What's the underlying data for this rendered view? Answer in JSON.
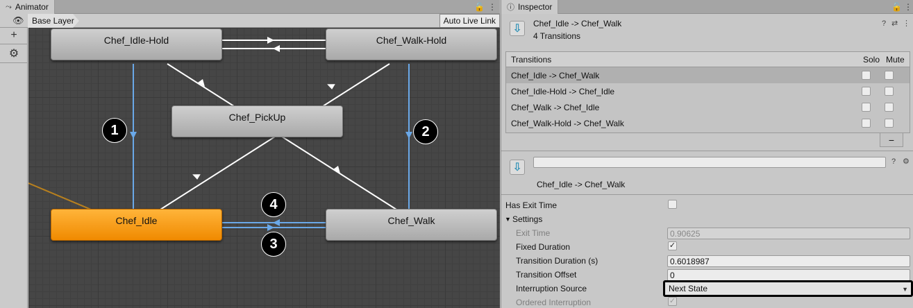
{
  "animator": {
    "tab_title": "Animator",
    "breadcrumb": "Base Layer",
    "auto_live_link": "Auto Live Link",
    "states": {
      "idle_hold": "Chef_Idle-Hold",
      "walk_hold": "Chef_Walk-Hold",
      "pickup": "Chef_PickUp",
      "idle": "Chef_Idle",
      "walk": "Chef_Walk"
    },
    "badges": [
      "1",
      "2",
      "3",
      "4"
    ],
    "colors": {
      "active_state": "#f39200",
      "highlight_transition": "#6aa8e8",
      "transition": "#ffffff",
      "entry_line": "#b8801e"
    }
  },
  "inspector": {
    "tab_title": "Inspector",
    "header_title": "Chef_Idle -> Chef_Walk",
    "header_subtitle": "4 Transitions",
    "transitions_header": "Transitions",
    "solo_label": "Solo",
    "mute_label": "Mute",
    "transitions": [
      "Chef_Idle -> Chef_Walk",
      "Chef_Idle-Hold -> Chef_Idle",
      "Chef_Walk -> Chef_Idle",
      "Chef_Walk-Hold -> Chef_Walk"
    ],
    "minus_label": "−",
    "selected_transition": "Chef_Idle -> Chef_Walk",
    "name_value": "",
    "has_exit_time_label": "Has Exit Time",
    "settings_label": "Settings",
    "exit_time_label": "Exit Time",
    "exit_time_value": "0.90625",
    "fixed_duration_label": "Fixed Duration",
    "transition_duration_label": "Transition Duration (s)",
    "transition_duration_value": "0.6018987",
    "transition_offset_label": "Transition Offset",
    "transition_offset_value": "0",
    "interruption_source_label": "Interruption Source",
    "interruption_source_value": "Next State",
    "ordered_interruption_label": "Ordered Interruption",
    "checkmark": "✓"
  }
}
